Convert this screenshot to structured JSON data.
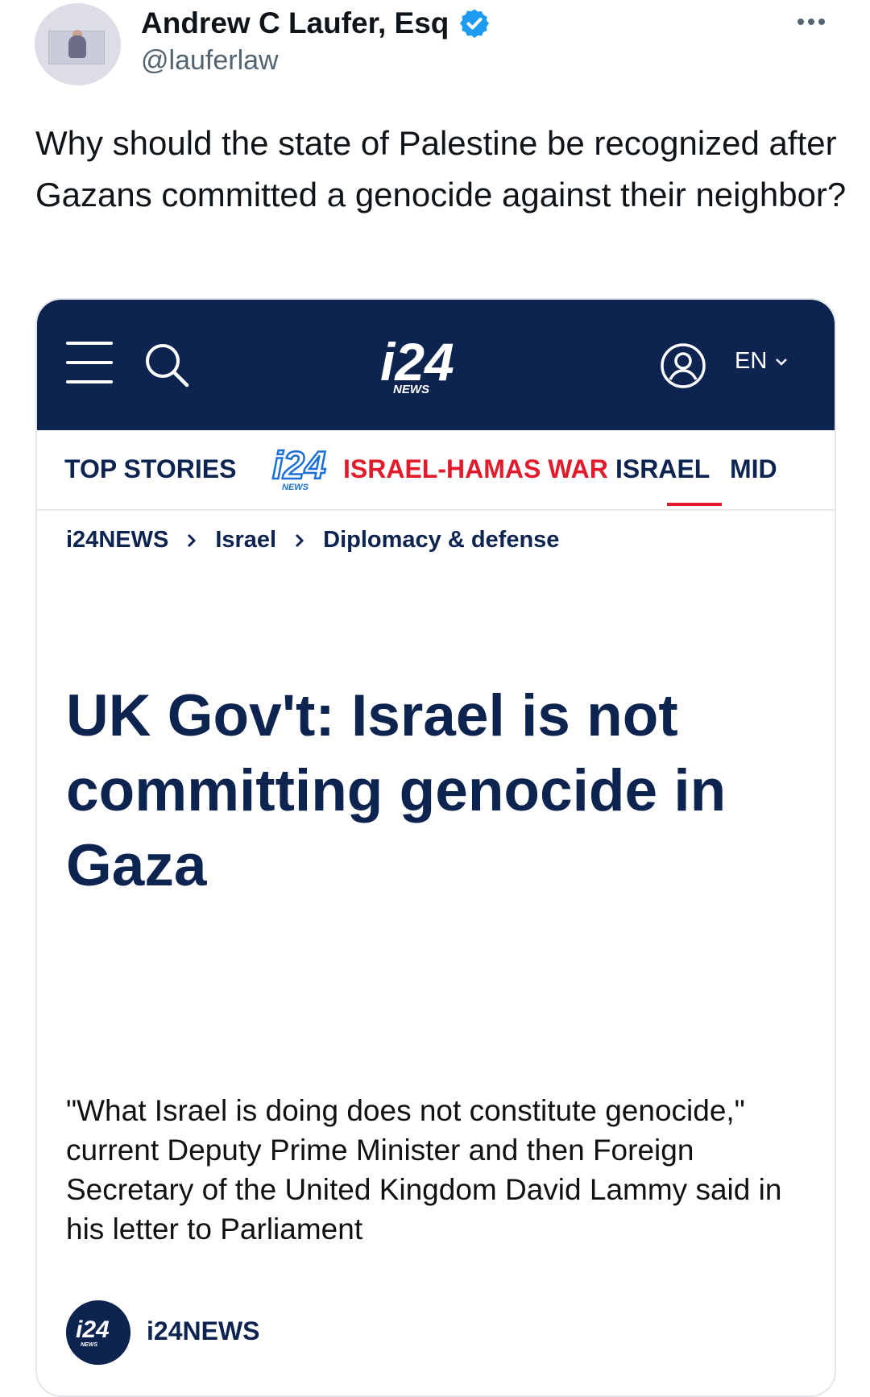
{
  "tweet": {
    "author_name": "Andrew C Laufer, Esq",
    "handle": "@lauferlaw",
    "text": "Why should the state of Palestine be recognized after Gazans committed a genocide against their neighbor?",
    "verified_color": "#1d9bf0"
  },
  "article": {
    "header": {
      "logo_text": "i24",
      "logo_sub": "NEWS",
      "language": "EN"
    },
    "nav": {
      "items": [
        {
          "label": "TOP STORIES",
          "color": "#0d2451"
        },
        {
          "label": "ISRAEL-HAMAS WAR",
          "color": "#e21b2c"
        },
        {
          "label": "ISRAEL",
          "color": "#0d2451",
          "active": true
        },
        {
          "label": "MID",
          "color": "#0d2451"
        }
      ]
    },
    "breadcrumb": [
      "i24NEWS",
      "Israel",
      "Diplomacy & defense"
    ],
    "headline": "UK Gov't: Israel is not committing genocide in Gaza",
    "lede": "\"What Israel is doing does not constitute genocide,\" current Deputy Prime Minister and then Foreign Secretary of the United Kingdom David Lammy said in his letter to Parliament",
    "source_name": "i24NEWS",
    "colors": {
      "navy": "#0d2451",
      "red": "#e21b2c"
    }
  }
}
